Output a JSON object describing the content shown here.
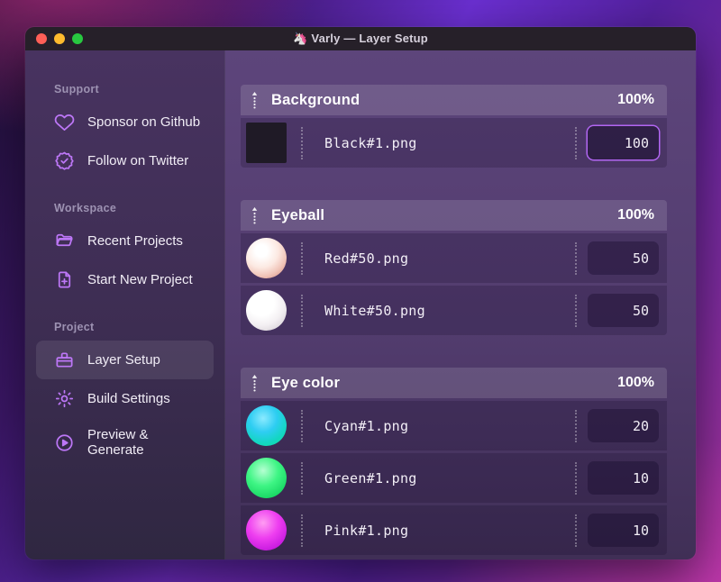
{
  "window": {
    "app_icon": "🦄",
    "title": "Varly — Layer Setup"
  },
  "colors": {
    "accent": "#bd77f7",
    "focus_border": "#b266f2"
  },
  "sidebar": {
    "sections": [
      {
        "label": "Support",
        "items": [
          {
            "icon": "heart-icon",
            "label": "Sponsor on Github",
            "active": false
          },
          {
            "icon": "verified-badge-icon",
            "label": "Follow on Twitter",
            "active": false
          }
        ]
      },
      {
        "label": "Workspace",
        "items": [
          {
            "icon": "folder-icon",
            "label": "Recent Projects",
            "active": false
          },
          {
            "icon": "file-plus-icon",
            "label": "Start New Project",
            "active": false
          }
        ]
      },
      {
        "label": "Project",
        "items": [
          {
            "icon": "layers-icon",
            "label": "Layer Setup",
            "active": true
          },
          {
            "icon": "gear-icon",
            "label": "Build Settings",
            "active": false
          },
          {
            "icon": "play-circle-icon",
            "label": "Preview & Generate",
            "active": false
          }
        ]
      }
    ]
  },
  "main": {
    "groups": [
      {
        "name": "Background",
        "weight": "100%",
        "layers": [
          {
            "thumb": "black-square",
            "file": "Black#1.png",
            "value": "100",
            "focused": true
          }
        ]
      },
      {
        "name": "Eyeball",
        "weight": "100%",
        "layers": [
          {
            "thumb": "red-sphere",
            "file": "Red#50.png",
            "value": "50",
            "focused": false
          },
          {
            "thumb": "white-sphere",
            "file": "White#50.png",
            "value": "50",
            "focused": false
          }
        ]
      },
      {
        "name": "Eye color",
        "weight": "100%",
        "layers": [
          {
            "thumb": "cyan-sphere",
            "file": "Cyan#1.png",
            "value": "20",
            "focused": false
          },
          {
            "thumb": "green-sphere",
            "file": "Green#1.png",
            "value": "10",
            "focused": false
          },
          {
            "thumb": "pink-sphere",
            "file": "Pink#1.png",
            "value": "10",
            "focused": false
          }
        ]
      }
    ]
  }
}
